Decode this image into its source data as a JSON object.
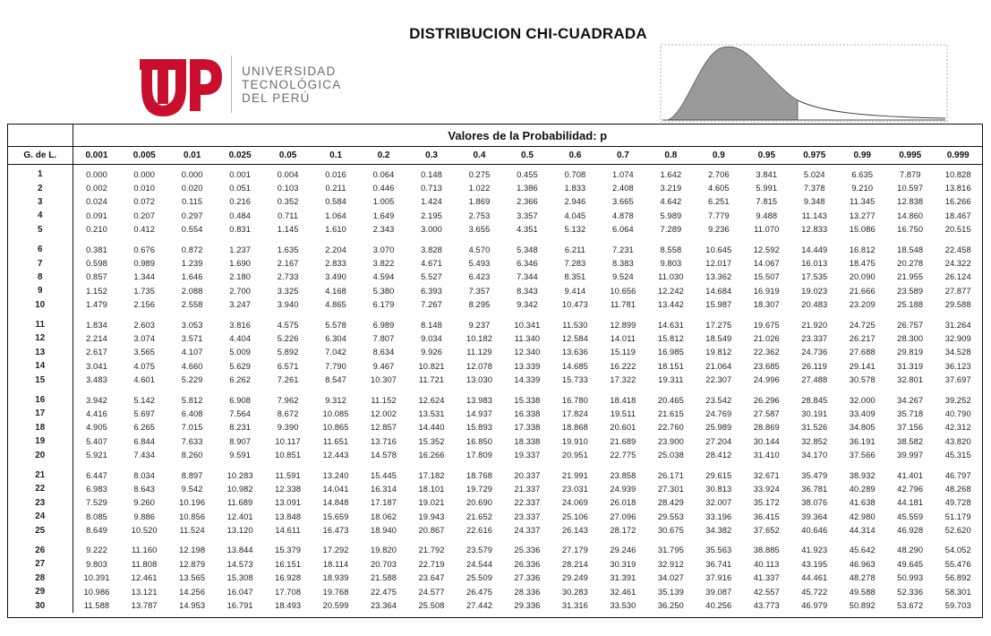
{
  "title": "DISTRIBUCION CHI-CUADRADA",
  "logo": {
    "line1": "UNIVERSIDAD",
    "line2": "TECNOLÓGICA",
    "line3": "DEL PERÚ",
    "brand_color": "#c8102e",
    "text_color": "#6b6b6b"
  },
  "figure": {
    "icon": "chi-square-density-curve",
    "fill_color": "#9a9a9a"
  },
  "table": {
    "probability_header": "Valores de la Probabilidad: p",
    "df_header": "G. de L.",
    "columns": [
      "0.001",
      "0.005",
      "0.01",
      "0.025",
      "0.05",
      "0.1",
      "0.2",
      "0.3",
      "0.4",
      "0.5",
      "0.6",
      "0.7",
      "0.8",
      "0.9",
      "0.95",
      "0.975",
      "0.99",
      "0.995",
      "0.999"
    ],
    "rows": [
      {
        "df": "1",
        "values": [
          "0.000",
          "0.000",
          "0.000",
          "0.001",
          "0.004",
          "0.016",
          "0.064",
          "0.148",
          "0.275",
          "0.455",
          "0.708",
          "1.074",
          "1.642",
          "2.706",
          "3.841",
          "5.024",
          "6.635",
          "7.879",
          "10.828"
        ]
      },
      {
        "df": "2",
        "values": [
          "0.002",
          "0.010",
          "0.020",
          "0.051",
          "0.103",
          "0.211",
          "0.446",
          "0.713",
          "1.022",
          "1.386",
          "1.833",
          "2.408",
          "3.219",
          "4.605",
          "5.991",
          "7.378",
          "9.210",
          "10.597",
          "13.816"
        ]
      },
      {
        "df": "3",
        "values": [
          "0.024",
          "0.072",
          "0.115",
          "0.216",
          "0.352",
          "0.584",
          "1.005",
          "1.424",
          "1.869",
          "2.366",
          "2.946",
          "3.665",
          "4.642",
          "6.251",
          "7.815",
          "9.348",
          "11.345",
          "12.838",
          "16.266"
        ]
      },
      {
        "df": "4",
        "values": [
          "0.091",
          "0.207",
          "0.297",
          "0.484",
          "0.711",
          "1.064",
          "1.649",
          "2.195",
          "2.753",
          "3.357",
          "4.045",
          "4.878",
          "5.989",
          "7.779",
          "9.488",
          "11.143",
          "13.277",
          "14.860",
          "18.467"
        ]
      },
      {
        "df": "5",
        "values": [
          "0.210",
          "0.412",
          "0.554",
          "0.831",
          "1.145",
          "1.610",
          "2.343",
          "3.000",
          "3.655",
          "4.351",
          "5.132",
          "6.064",
          "7.289",
          "9.236",
          "11.070",
          "12.833",
          "15.086",
          "16.750",
          "20.515"
        ]
      },
      {
        "df": "6",
        "values": [
          "0.381",
          "0.676",
          "0.872",
          "1.237",
          "1.635",
          "2.204",
          "3.070",
          "3.828",
          "4.570",
          "5.348",
          "6.211",
          "7.231",
          "8.558",
          "10.645",
          "12.592",
          "14.449",
          "16.812",
          "18.548",
          "22.458"
        ]
      },
      {
        "df": "7",
        "values": [
          "0.598",
          "0.989",
          "1.239",
          "1.690",
          "2.167",
          "2.833",
          "3.822",
          "4.671",
          "5.493",
          "6.346",
          "7.283",
          "8.383",
          "9.803",
          "12.017",
          "14.067",
          "16.013",
          "18.475",
          "20.278",
          "24.322"
        ]
      },
      {
        "df": "8",
        "values": [
          "0.857",
          "1.344",
          "1.646",
          "2.180",
          "2.733",
          "3.490",
          "4.594",
          "5.527",
          "6.423",
          "7.344",
          "8.351",
          "9.524",
          "11.030",
          "13.362",
          "15.507",
          "17.535",
          "20.090",
          "21.955",
          "26.124"
        ]
      },
      {
        "df": "9",
        "values": [
          "1.152",
          "1.735",
          "2.088",
          "2.700",
          "3.325",
          "4.168",
          "5.380",
          "6.393",
          "7.357",
          "8.343",
          "9.414",
          "10.656",
          "12.242",
          "14.684",
          "16.919",
          "19.023",
          "21.666",
          "23.589",
          "27.877"
        ]
      },
      {
        "df": "10",
        "values": [
          "1.479",
          "2.156",
          "2.558",
          "3.247",
          "3.940",
          "4.865",
          "6.179",
          "7.267",
          "8.295",
          "9.342",
          "10.473",
          "11.781",
          "13.442",
          "15.987",
          "18.307",
          "20.483",
          "23.209",
          "25.188",
          "29.588"
        ]
      },
      {
        "df": "11",
        "values": [
          "1.834",
          "2.603",
          "3.053",
          "3.816",
          "4.575",
          "5.578",
          "6.989",
          "8.148",
          "9.237",
          "10.341",
          "11.530",
          "12.899",
          "14.631",
          "17.275",
          "19.675",
          "21.920",
          "24.725",
          "26.757",
          "31.264"
        ]
      },
      {
        "df": "12",
        "values": [
          "2.214",
          "3.074",
          "3.571",
          "4.404",
          "5.226",
          "6.304",
          "7.807",
          "9.034",
          "10.182",
          "11.340",
          "12.584",
          "14.011",
          "15.812",
          "18.549",
          "21.026",
          "23.337",
          "26.217",
          "28.300",
          "32.909"
        ]
      },
      {
        "df": "13",
        "values": [
          "2.617",
          "3.565",
          "4.107",
          "5.009",
          "5.892",
          "7.042",
          "8.634",
          "9.926",
          "11.129",
          "12.340",
          "13.636",
          "15.119",
          "16.985",
          "19.812",
          "22.362",
          "24.736",
          "27.688",
          "29.819",
          "34.528"
        ]
      },
      {
        "df": "14",
        "values": [
          "3.041",
          "4.075",
          "4.660",
          "5.629",
          "6.571",
          "7.790",
          "9.467",
          "10.821",
          "12.078",
          "13.339",
          "14.685",
          "16.222",
          "18.151",
          "21.064",
          "23.685",
          "26.119",
          "29.141",
          "31.319",
          "36.123"
        ]
      },
      {
        "df": "15",
        "values": [
          "3.483",
          "4.601",
          "5.229",
          "6.262",
          "7.261",
          "8.547",
          "10.307",
          "11.721",
          "13.030",
          "14.339",
          "15.733",
          "17.322",
          "19.311",
          "22.307",
          "24.996",
          "27.488",
          "30.578",
          "32.801",
          "37.697"
        ]
      },
      {
        "df": "16",
        "values": [
          "3.942",
          "5.142",
          "5.812",
          "6.908",
          "7.962",
          "9.312",
          "11.152",
          "12.624",
          "13.983",
          "15.338",
          "16.780",
          "18.418",
          "20.465",
          "23.542",
          "26.296",
          "28.845",
          "32.000",
          "34.267",
          "39.252"
        ]
      },
      {
        "df": "17",
        "values": [
          "4.416",
          "5.697",
          "6.408",
          "7.564",
          "8.672",
          "10.085",
          "12.002",
          "13.531",
          "14.937",
          "16.338",
          "17.824",
          "19.511",
          "21.615",
          "24.769",
          "27.587",
          "30.191",
          "33.409",
          "35.718",
          "40.790"
        ]
      },
      {
        "df": "18",
        "values": [
          "4.905",
          "6.265",
          "7.015",
          "8.231",
          "9.390",
          "10.865",
          "12.857",
          "14.440",
          "15.893",
          "17.338",
          "18.868",
          "20.601",
          "22.760",
          "25.989",
          "28.869",
          "31.526",
          "34.805",
          "37.156",
          "42.312"
        ]
      },
      {
        "df": "19",
        "values": [
          "5.407",
          "6.844",
          "7.633",
          "8.907",
          "10.117",
          "11.651",
          "13.716",
          "15.352",
          "16.850",
          "18.338",
          "19.910",
          "21.689",
          "23.900",
          "27.204",
          "30.144",
          "32.852",
          "36.191",
          "38.582",
          "43.820"
        ]
      },
      {
        "df": "20",
        "values": [
          "5.921",
          "7.434",
          "8.260",
          "9.591",
          "10.851",
          "12.443",
          "14.578",
          "16.266",
          "17.809",
          "19.337",
          "20.951",
          "22.775",
          "25.038",
          "28.412",
          "31.410",
          "34.170",
          "37.566",
          "39.997",
          "45.315"
        ]
      },
      {
        "df": "21",
        "values": [
          "6.447",
          "8.034",
          "8.897",
          "10.283",
          "11.591",
          "13.240",
          "15.445",
          "17.182",
          "18.768",
          "20.337",
          "21.991",
          "23.858",
          "26.171",
          "29.615",
          "32.671",
          "35.479",
          "38.932",
          "41.401",
          "46.797"
        ]
      },
      {
        "df": "22",
        "values": [
          "6.983",
          "8.643",
          "9.542",
          "10.982",
          "12.338",
          "14.041",
          "16.314",
          "18.101",
          "19.729",
          "21.337",
          "23.031",
          "24.939",
          "27.301",
          "30.813",
          "33.924",
          "36.781",
          "40.289",
          "42.796",
          "48.268"
        ]
      },
      {
        "df": "23",
        "values": [
          "7.529",
          "9.260",
          "10.196",
          "11.689",
          "13.091",
          "14.848",
          "17.187",
          "19.021",
          "20.690",
          "22.337",
          "24.069",
          "26.018",
          "28.429",
          "32.007",
          "35.172",
          "38.076",
          "41.638",
          "44.181",
          "49.728"
        ]
      },
      {
        "df": "24",
        "values": [
          "8.085",
          "9.886",
          "10.856",
          "12.401",
          "13.848",
          "15.659",
          "18.062",
          "19.943",
          "21.652",
          "23.337",
          "25.106",
          "27.096",
          "29.553",
          "33.196",
          "36.415",
          "39.364",
          "42.980",
          "45.559",
          "51.179"
        ]
      },
      {
        "df": "25",
        "values": [
          "8.649",
          "10.520",
          "11.524",
          "13.120",
          "14.611",
          "16.473",
          "18.940",
          "20.867",
          "22.616",
          "24.337",
          "26.143",
          "28.172",
          "30.675",
          "34.382",
          "37.652",
          "40.646",
          "44.314",
          "46.928",
          "52.620"
        ]
      },
      {
        "df": "26",
        "values": [
          "9.222",
          "11.160",
          "12.198",
          "13.844",
          "15.379",
          "17.292",
          "19.820",
          "21.792",
          "23.579",
          "25.336",
          "27.179",
          "29.246",
          "31.795",
          "35.563",
          "38.885",
          "41.923",
          "45.642",
          "48.290",
          "54.052"
        ]
      },
      {
        "df": "27",
        "values": [
          "9.803",
          "11.808",
          "12.879",
          "14.573",
          "16.151",
          "18.114",
          "20.703",
          "22.719",
          "24.544",
          "26.336",
          "28.214",
          "30.319",
          "32.912",
          "36.741",
          "40.113",
          "43.195",
          "46.963",
          "49.645",
          "55.476"
        ]
      },
      {
        "df": "28",
        "values": [
          "10.391",
          "12.461",
          "13.565",
          "15.308",
          "16.928",
          "18.939",
          "21.588",
          "23.647",
          "25.509",
          "27.336",
          "29.249",
          "31.391",
          "34.027",
          "37.916",
          "41.337",
          "44.461",
          "48.278",
          "50.993",
          "56.892"
        ]
      },
      {
        "df": "29",
        "values": [
          "10.986",
          "13.121",
          "14.256",
          "16.047",
          "17.708",
          "19.768",
          "22.475",
          "24.577",
          "26.475",
          "28.336",
          "30.283",
          "32.461",
          "35.139",
          "39.087",
          "42.557",
          "45.722",
          "49.588",
          "52.336",
          "58.301"
        ]
      },
      {
        "df": "30",
        "values": [
          "11.588",
          "13.787",
          "14.953",
          "16.791",
          "18.493",
          "20.599",
          "23.364",
          "25.508",
          "27.442",
          "29.336",
          "31.316",
          "33.530",
          "36.250",
          "40.256",
          "43.773",
          "46.979",
          "50.892",
          "53.672",
          "59.703"
        ]
      }
    ]
  }
}
